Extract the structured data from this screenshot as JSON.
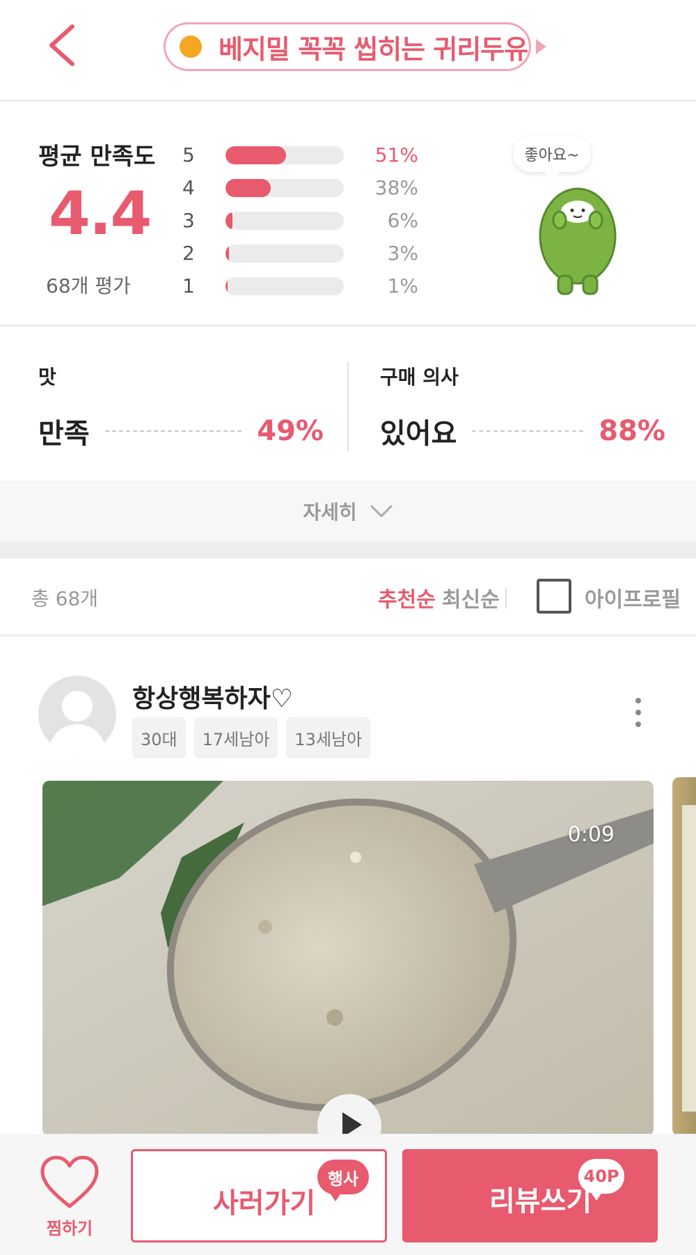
{
  "header": {
    "back_icon": "chevron-left-icon",
    "product_name": "베지밀 꼭꼭 씹히는 귀리두유",
    "colors": {
      "accent": "#e85a6e",
      "dot": "#f5a623"
    }
  },
  "rating": {
    "avg_label": "평균 만족도",
    "avg_score": "4.4",
    "count_label": "68개 평가",
    "distribution": [
      {
        "star": "5",
        "percent_label": "51%",
        "percent": 51
      },
      {
        "star": "4",
        "percent_label": "38%",
        "percent": 38
      },
      {
        "star": "3",
        "percent_label": "6%",
        "percent": 6
      },
      {
        "star": "2",
        "percent_label": "3%",
        "percent": 3
      },
      {
        "star": "1",
        "percent_label": "1%",
        "percent": 1
      }
    ],
    "speech": "좋아요~"
  },
  "stats": {
    "taste": {
      "title": "맛",
      "value": "만족",
      "percent": "49%"
    },
    "purchase": {
      "title": "구매 의사",
      "value": "있어요",
      "percent": "88%"
    },
    "more_label": "자세히"
  },
  "filter": {
    "total": "총 68개",
    "sort_recommended": "추천순",
    "sort_latest": "최신순",
    "iprofile_label": "아이프로필"
  },
  "review": {
    "username": "항상행복하자♡",
    "tags": [
      "30대",
      "17세남아",
      "13세남아"
    ],
    "video_duration": "0:09"
  },
  "bottom": {
    "wish_label": "찜하기",
    "buy_label": "사러가기",
    "buy_badge": "행사",
    "review_label": "리뷰쓰기",
    "review_badge": "40P"
  }
}
